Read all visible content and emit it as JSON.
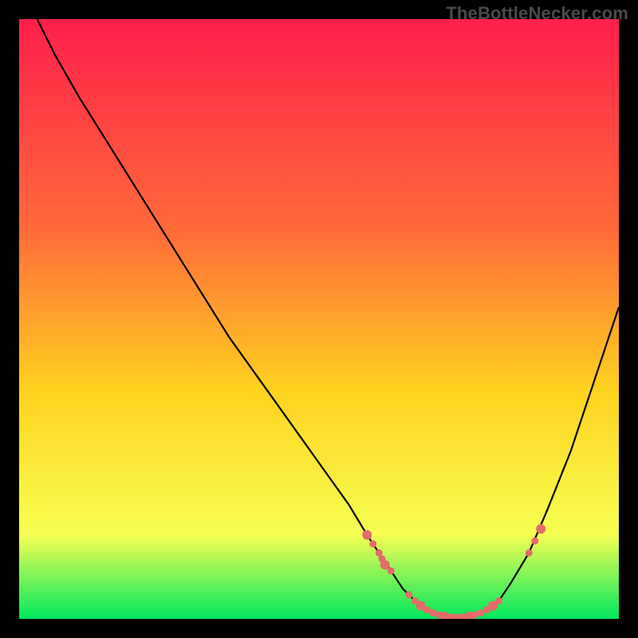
{
  "watermark": "TheBottleNecker.com",
  "gradient": {
    "top": "#ff1f4b",
    "mid1": "#ff6a3a",
    "mid2": "#ffd21f",
    "mid3": "#f7ff52",
    "bottom": "#00e85e"
  },
  "curve_color": "#000000",
  "marker_color": "#e66a6a",
  "chart_data": {
    "type": "line",
    "title": "",
    "xlabel": "",
    "ylabel": "",
    "xlim": [
      0,
      100
    ],
    "ylim": [
      0,
      100
    ],
    "series": [
      {
        "name": "bottleneck-curve",
        "x": [
          3,
          6,
          10,
          15,
          20,
          25,
          30,
          35,
          40,
          45,
          50,
          55,
          58,
          60,
          62,
          64,
          66,
          68,
          70,
          72,
          74,
          76,
          78,
          80,
          82,
          85,
          88,
          92,
          96,
          100
        ],
        "y": [
          100,
          94,
          87,
          79,
          71,
          63,
          55,
          47,
          40,
          33,
          26,
          19,
          14,
          11,
          8,
          5,
          3,
          1.5,
          0.7,
          0.3,
          0.3,
          0.7,
          1.5,
          3,
          6,
          11,
          18,
          28,
          40,
          52
        ]
      }
    ],
    "markers": {
      "name": "highlighted-points",
      "x": [
        58,
        59,
        60,
        60.5,
        61,
        62,
        65,
        66,
        67,
        68,
        69,
        70,
        71,
        72,
        73,
        74,
        75,
        76,
        77,
        78,
        79,
        80,
        85,
        86,
        87
      ],
      "y": [
        14,
        12.5,
        11,
        10,
        9,
        8,
        4,
        3,
        2.2,
        1.5,
        1,
        0.7,
        0.4,
        0.3,
        0.3,
        0.3,
        0.4,
        0.7,
        1,
        1.5,
        2.2,
        3,
        11,
        13,
        15
      ]
    }
  }
}
